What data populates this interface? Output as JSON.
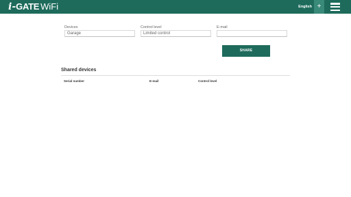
{
  "header": {
    "logo_i": "i-",
    "logo_gate": "GATE",
    "logo_wifi": "WiFi",
    "language": "English",
    "add_label": "+",
    "brand_color": "#1e6b5c",
    "menu_icon": "hamburger-menu-icon"
  },
  "form": {
    "devices_label": "Devices",
    "devices_value": "Garage",
    "control_label": "Control level",
    "control_value": "Limited control",
    "email_label": "E-mail",
    "email_value": "",
    "share_label": "SHARE"
  },
  "shared": {
    "title": "Shared devices",
    "columns": [
      "Serial number",
      "E-mail",
      "Control level"
    ],
    "rows": []
  }
}
